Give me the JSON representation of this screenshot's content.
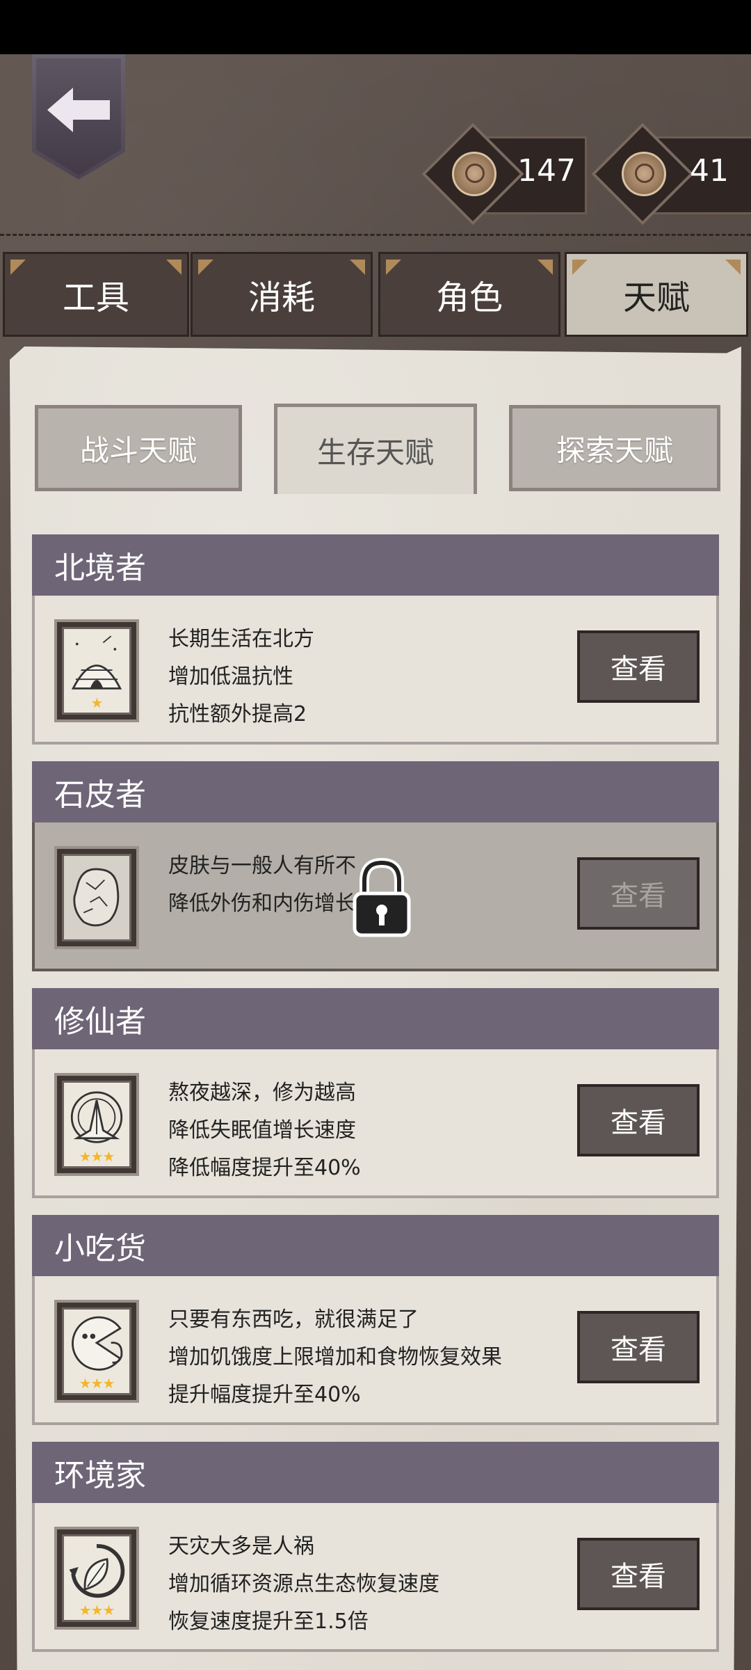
{
  "currency": [
    {
      "icon": "coin-icon",
      "value": "147"
    },
    {
      "icon": "medal-icon",
      "value": "41"
    }
  ],
  "main_tabs": [
    {
      "label": "工具"
    },
    {
      "label": "消耗"
    },
    {
      "label": "角色"
    },
    {
      "label": "天赋",
      "active": true
    }
  ],
  "sub_tabs": [
    {
      "label": "战斗天赋"
    },
    {
      "label": "生存天赋",
      "active": true
    },
    {
      "label": "探索天赋"
    }
  ],
  "talents": [
    {
      "name": "北境者",
      "lines": [
        "长期生活在北方",
        "增加低温抗性",
        "抗性额外提高2"
      ],
      "stars": "★",
      "icon": "igloo-icon",
      "button": "查看",
      "locked": false
    },
    {
      "name": "石皮者",
      "lines": [
        "皮肤与一般人有所不",
        "降低外伤和内伤增长"
      ],
      "stars": "",
      "icon": "rock-icon",
      "button": "查看",
      "locked": true
    },
    {
      "name": "修仙者",
      "lines": [
        "熬夜越深，修为越高",
        "降低失眠值增长速度",
        "降低幅度提升至40%"
      ],
      "stars": "★★★",
      "icon": "praying-hands-icon",
      "button": "查看",
      "locked": false
    },
    {
      "name": "小吃货",
      "lines": [
        "只要有东西吃，就很满足了",
        "增加饥饿度上限增加和食物恢复效果",
        "提升幅度提升至40%"
      ],
      "stars": "★★★",
      "icon": "eating-face-icon",
      "button": "查看",
      "locked": false
    },
    {
      "name": "环境家",
      "lines": [
        "天灾大多是人祸",
        "增加循环资源点生态恢复速度",
        "恢复速度提升至1.5倍"
      ],
      "stars": "★★★",
      "icon": "leaf-recycle-icon",
      "button": "查看",
      "locked": false
    }
  ]
}
